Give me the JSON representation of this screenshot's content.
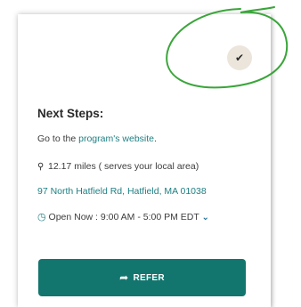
{
  "next_steps": {
    "title": "Next Steps:",
    "website_prefix": "Go to the ",
    "website_link": "program's website",
    "website_suffix": "."
  },
  "location": {
    "distance": "12.17 miles ( serves your local area)",
    "address": "97 North Hatfield Rd, Hatfield, MA 01038"
  },
  "hours": {
    "text": "Open Now : 9:00 AM - 5:00 PM EDT"
  },
  "refer_button": {
    "label": "REFER"
  },
  "icons": {
    "check": "check-icon",
    "pin": "map-pin-icon",
    "clock": "clock-icon",
    "chevron": "chevron-down-icon",
    "refer": "share-arrow-icon"
  },
  "colors": {
    "teal": "#13766e",
    "link": "#1f7f83",
    "highlight_circle": "#3aa53a"
  }
}
